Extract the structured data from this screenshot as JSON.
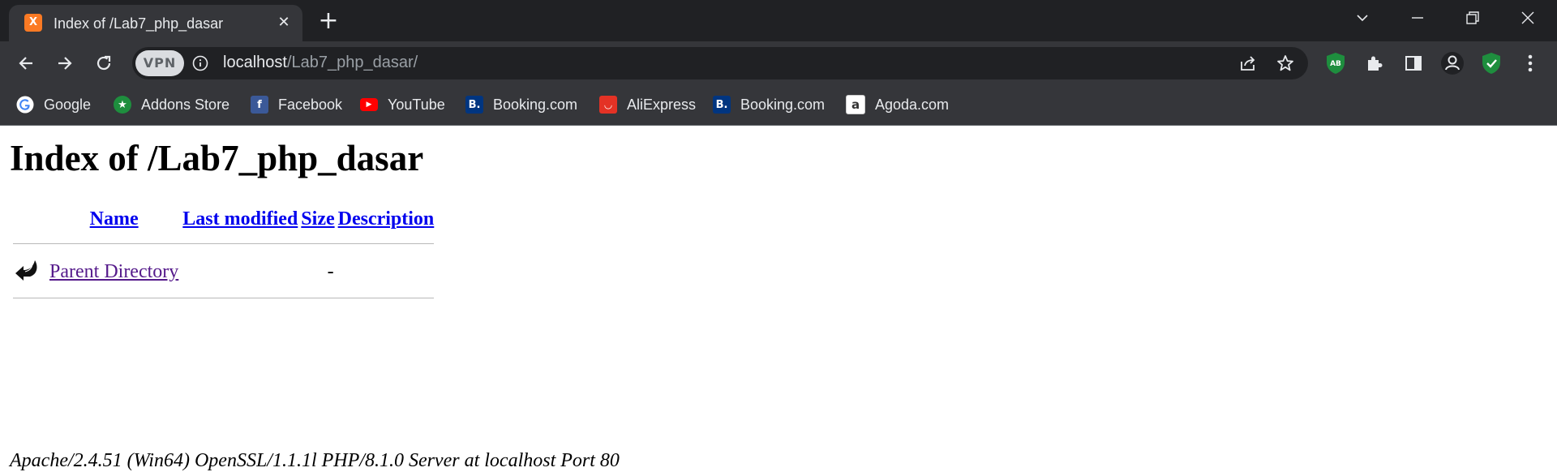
{
  "browser": {
    "tab": {
      "title": "Index of /Lab7_php_dasar",
      "favicon": "xampp-icon",
      "favicon_color": "#fb7a24"
    },
    "omnibox": {
      "vpn_label": "VPN",
      "url_host": "localhost",
      "url_path": "/Lab7_php_dasar/"
    },
    "extensions": [
      {
        "name": "adblock-icon",
        "label": "AB"
      },
      {
        "name": "extensions-puzzle-icon"
      },
      {
        "name": "side-panel-icon"
      },
      {
        "name": "profile-icon"
      },
      {
        "name": "security-shield-icon"
      }
    ],
    "bookmarks": [
      {
        "label": "Google",
        "icon": "google-icon"
      },
      {
        "label": "Addons Store",
        "icon": "addons-store-icon"
      },
      {
        "label": "Facebook",
        "icon": "facebook-icon"
      },
      {
        "label": "YouTube",
        "icon": "youtube-icon"
      },
      {
        "label": "Booking.com",
        "icon": "booking-icon"
      },
      {
        "label": "AliExpress",
        "icon": "aliexpress-icon"
      },
      {
        "label": "Booking.com",
        "icon": "booking-icon"
      },
      {
        "label": "Agoda.com",
        "icon": "agoda-icon"
      }
    ]
  },
  "page": {
    "heading": "Index of /Lab7_php_dasar",
    "columns": {
      "name": "Name",
      "last_modified": "Last modified",
      "size": "Size",
      "description": "Description"
    },
    "rows": [
      {
        "icon": "back-arrow-icon",
        "name": "Parent Directory",
        "last_modified": "",
        "size": "-",
        "description": ""
      }
    ],
    "footer": "Apache/2.4.51 (Win64) OpenSSL/1.1.1l PHP/8.1.0 Server at localhost Port 80"
  }
}
